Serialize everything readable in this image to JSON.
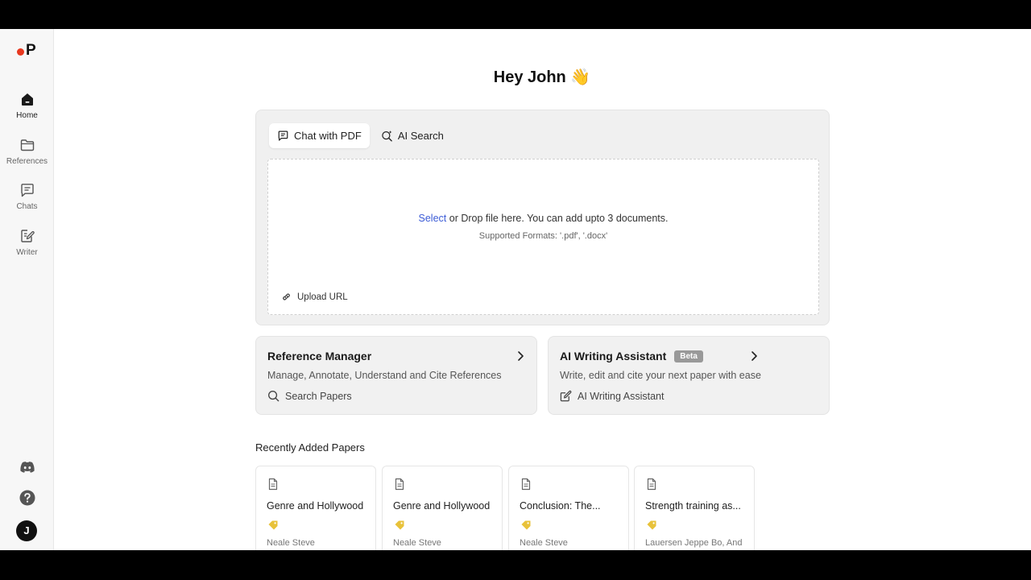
{
  "logo": {
    "letter": "P"
  },
  "nav": [
    {
      "label": "Home",
      "icon": "home-icon",
      "active": true
    },
    {
      "label": "References",
      "icon": "folder-icon",
      "active": false
    },
    {
      "label": "Chats",
      "icon": "chat-icon",
      "active": false
    },
    {
      "label": "Writer",
      "icon": "pen-square-icon",
      "active": false
    }
  ],
  "sidebar_bottom": {
    "discord_icon": "discord-icon",
    "help_icon": "help-icon",
    "avatar_initial": "J"
  },
  "greeting": {
    "text": "Hey John",
    "emoji": "👋"
  },
  "upload": {
    "tabs": [
      {
        "label": "Chat with PDF",
        "icon": "chat-icon",
        "active": true
      },
      {
        "label": "AI Search",
        "icon": "ai-search-icon",
        "active": false
      }
    ],
    "select_link": "Select",
    "drop_text": "or Drop file here. You can add upto 3 documents.",
    "supported": "Supported Formats: '.pdf', '.docx'",
    "upload_url": "Upload URL"
  },
  "cards": {
    "reference": {
      "title": "Reference Manager",
      "desc": "Manage, Annotate, Understand and Cite References",
      "action": "Search Papers"
    },
    "writing": {
      "title": "AI Writing Assistant",
      "badge": "Beta",
      "desc": "Write, edit and cite your next paper with ease",
      "action": "AI Writing Assistant"
    }
  },
  "recent": {
    "title": "Recently Added Papers",
    "papers": [
      {
        "title": "Genre and Hollywood",
        "author": "Neale Steve"
      },
      {
        "title": "Genre and Hollywood",
        "author": "Neale Steve"
      },
      {
        "title": "Conclusion: The...",
        "author": "Neale Steve"
      },
      {
        "title": "Strength training as...",
        "author": "Lauersen Jeppe Bo, And"
      }
    ]
  },
  "colors": {
    "accent_red": "#e8381f",
    "link_blue": "#3b5bd6",
    "tag_yellow": "#e8c23a"
  }
}
